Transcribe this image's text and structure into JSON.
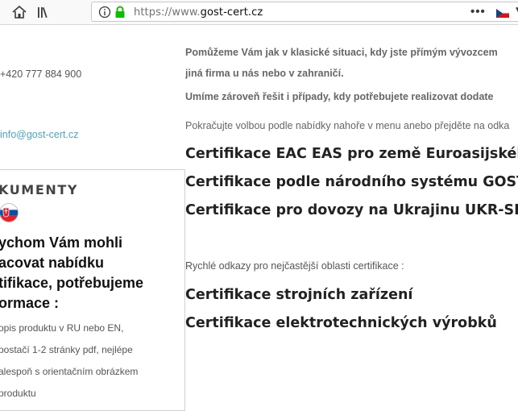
{
  "browser": {
    "url_scheme": "https://www.",
    "url_host": "gost-cert.cz",
    "menu_dots": "•••"
  },
  "sidebar": {
    "phone": "+420 777 884 900",
    "email": "info@gost-cert.cz",
    "documents_title": "KUMENTY",
    "heading_lines": [
      "ychom Vám mohli",
      "acovat nabídku",
      "tifikace, potřebujeme",
      "ormace :"
    ],
    "list_lines": [
      "opis produktu v RU nebo EN,",
      "postačí 1-2 stránky pdf, nejlépe",
      "alespoň s orientačním obrázkem",
      "produktu"
    ]
  },
  "main": {
    "intro_line1": "Pomůžeme Vám jak v klasické situaci, kdy jste přímým vývozcem",
    "intro_line2": "jiná  firma u nás nebo v zahraničí.",
    "intro_para2": "Umíme zároveň řešit i případy, kdy potřebujete realizovat dodate",
    "intro_para3": "Pokračujte volbou podle nabídky nahoře v menu anebo přejděte na odka",
    "links": [
      "Certifikace EAC EAS pro země Euroasijského sp",
      "Certifikace podle národního systému GOST-R",
      "Certifikace pro dovozy na Ukrajinu UKR-SEPRO"
    ],
    "quick_links_label": "Rychlé  odkazy pro nejčastější oblasti certifikace :",
    "quick_links": [
      "Certifikace strojních zařízení",
      "Certifikace elektrotechnických výrobků"
    ]
  }
}
